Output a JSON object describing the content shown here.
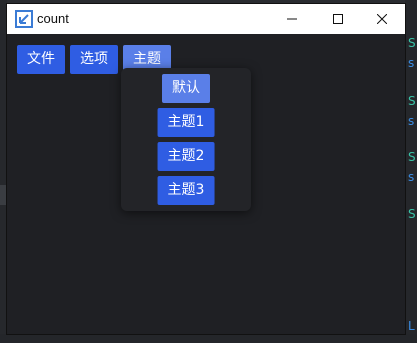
{
  "window": {
    "title": "count"
  },
  "menubar": {
    "items": [
      "文件",
      "选项",
      "主题"
    ],
    "active_index": 2
  },
  "theme_menu": {
    "items": [
      "默认",
      "主题1",
      "主题2",
      "主题3"
    ],
    "selected_index": 0
  },
  "colors": {
    "accent": "#2f5de3",
    "accent_active": "#5a7fe8",
    "surface": "#1f2024",
    "titlebar": "#ffffff"
  },
  "background_editor": {
    "right_glyphs": [
      "S",
      "s",
      "S",
      "s",
      "S",
      "s",
      "S",
      "L"
    ]
  }
}
